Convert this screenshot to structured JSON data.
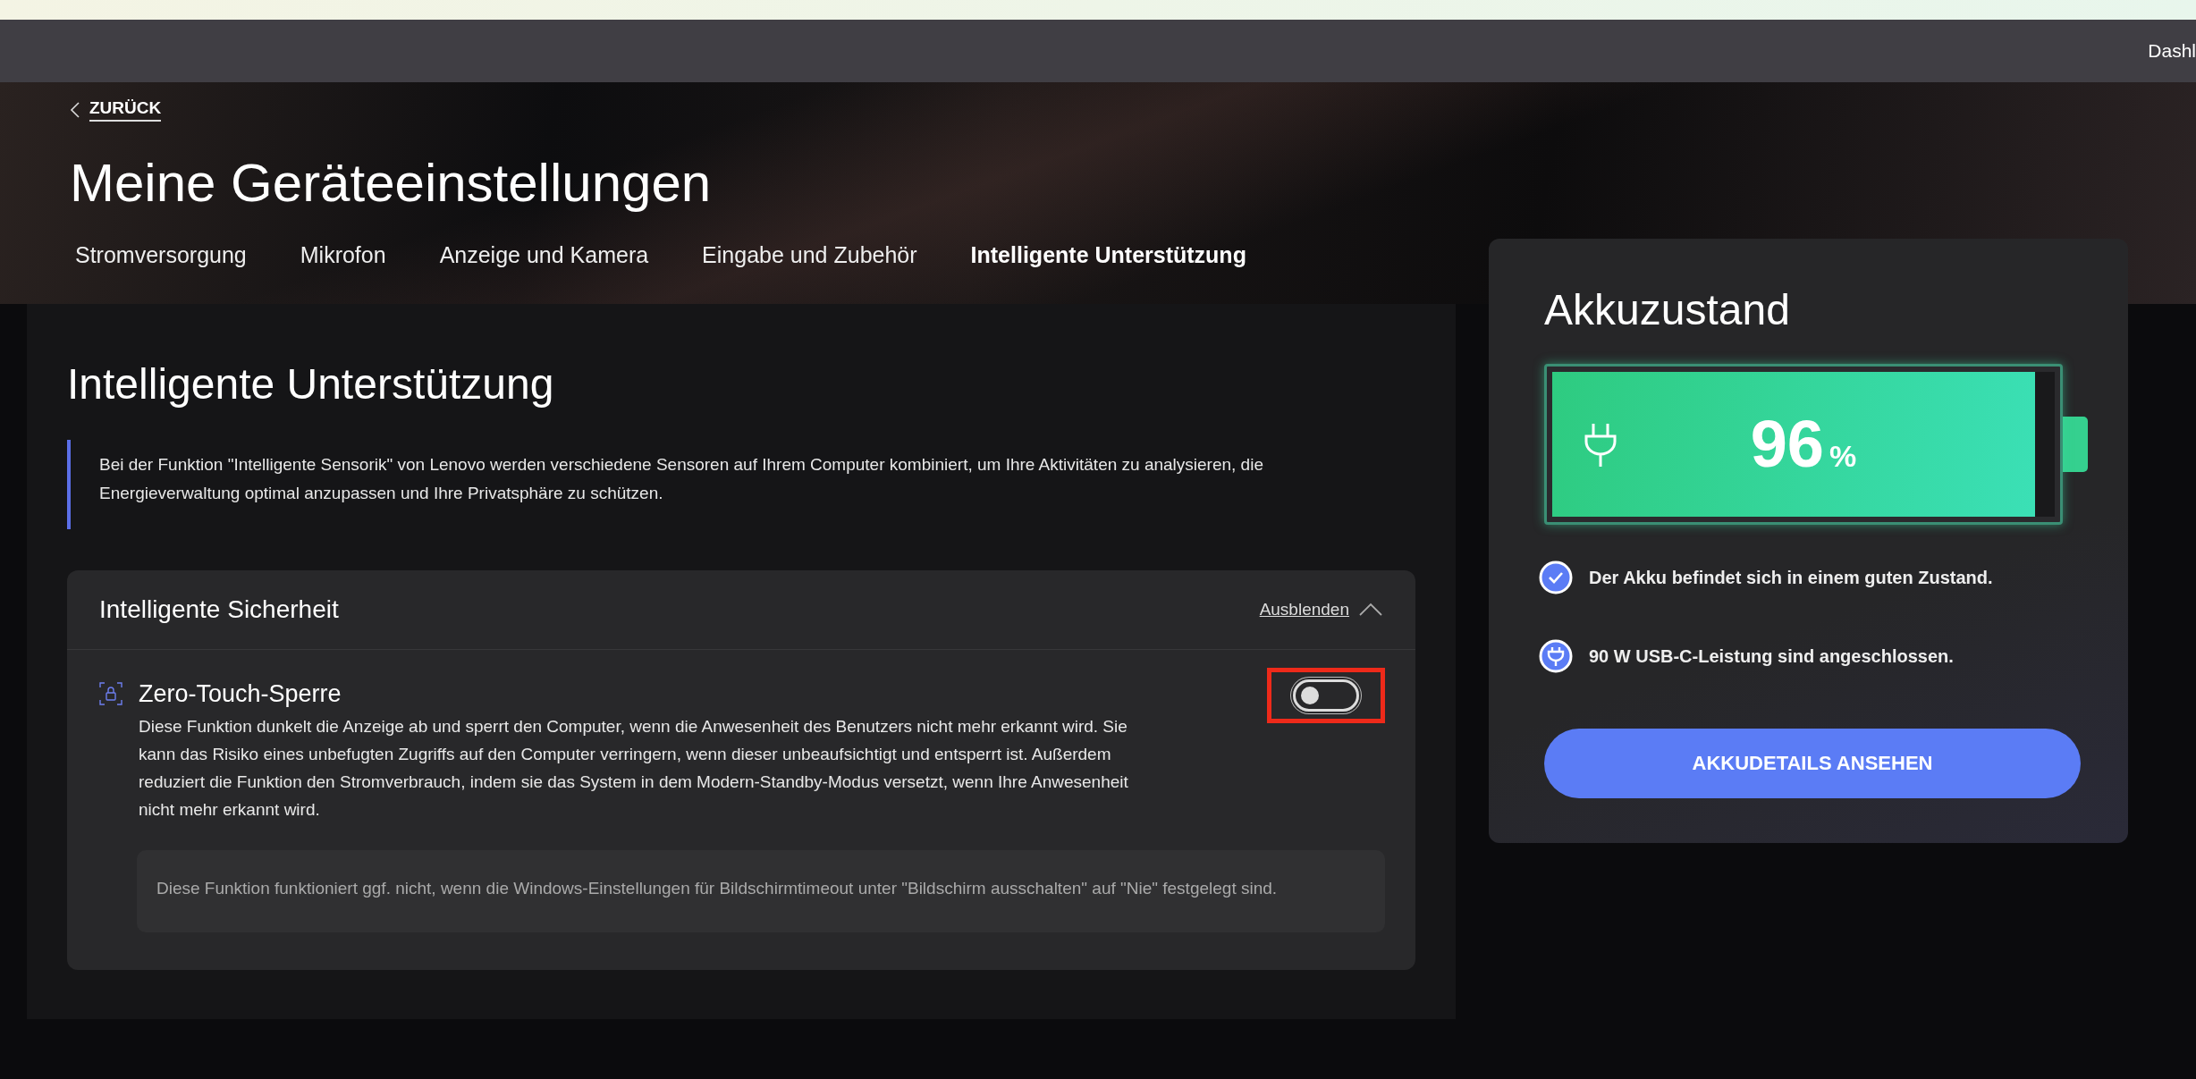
{
  "top_bar": {
    "text": "Dashl"
  },
  "header": {
    "back": "ZURÜCK",
    "title": "Meine Geräteeinstellungen",
    "tabs": [
      {
        "label": "Stromversorgung",
        "selected": false
      },
      {
        "label": "Mikrofon",
        "selected": false
      },
      {
        "label": "Anzeige und Kamera",
        "selected": false
      },
      {
        "label": "Eingabe und Zubehör",
        "selected": false
      },
      {
        "label": "Intelligente Unterstützung",
        "selected": true
      }
    ]
  },
  "section": {
    "title": "Intelligente Unterstützung",
    "description": "Bei der Funktion \"Intelligente Sensorik\" von Lenovo werden verschiedene Sensoren auf Ihrem Computer kombiniert, um Ihre Aktivitäten zu analysieren, die Energieverwaltung optimal anzupassen und Ihre Privatsphäre zu schützen.",
    "group": {
      "title": "Intelligente Sicherheit",
      "collapse_link": "Ausblenden",
      "expanded": true,
      "features": [
        {
          "title": "Zero-Touch-Sperre",
          "description": "Diese Funktion dunkelt die Anzeige ab und sperrt den Computer, wenn die Anwesenheit des Benutzers nicht mehr erkannt wird. Sie kann das Risiko eines unbefugten Zugriffs auf den Computer verringern, wenn dieser unbeaufsichtigt und entsperrt ist. Außerdem reduziert die Funktion den Stromverbrauch, indem sie das System in dem Modern-Standby-Modus versetzt, wenn Ihre Anwesenheit nicht mehr erkannt wird.",
          "on": false,
          "highlighted": true,
          "note": "Diese Funktion funktioniert ggf. nicht, wenn die Windows-Einstellungen für Bildschirmtimeout unter \"Bildschirm ausschalten\" auf \"Nie\" festgelegt sind."
        }
      ]
    }
  },
  "battery": {
    "title": "Akkuzustand",
    "level": 0.96,
    "percent": "96",
    "unit": "%",
    "charging": true,
    "statuses": [
      {
        "kind": "check",
        "text": "Der Akku befindet sich in einem guten Zustand."
      },
      {
        "kind": "plug",
        "text": "90 W USB-C-Leistung sind angeschlossen."
      }
    ],
    "button": "AKKUDETAILS ANSEHEN"
  }
}
